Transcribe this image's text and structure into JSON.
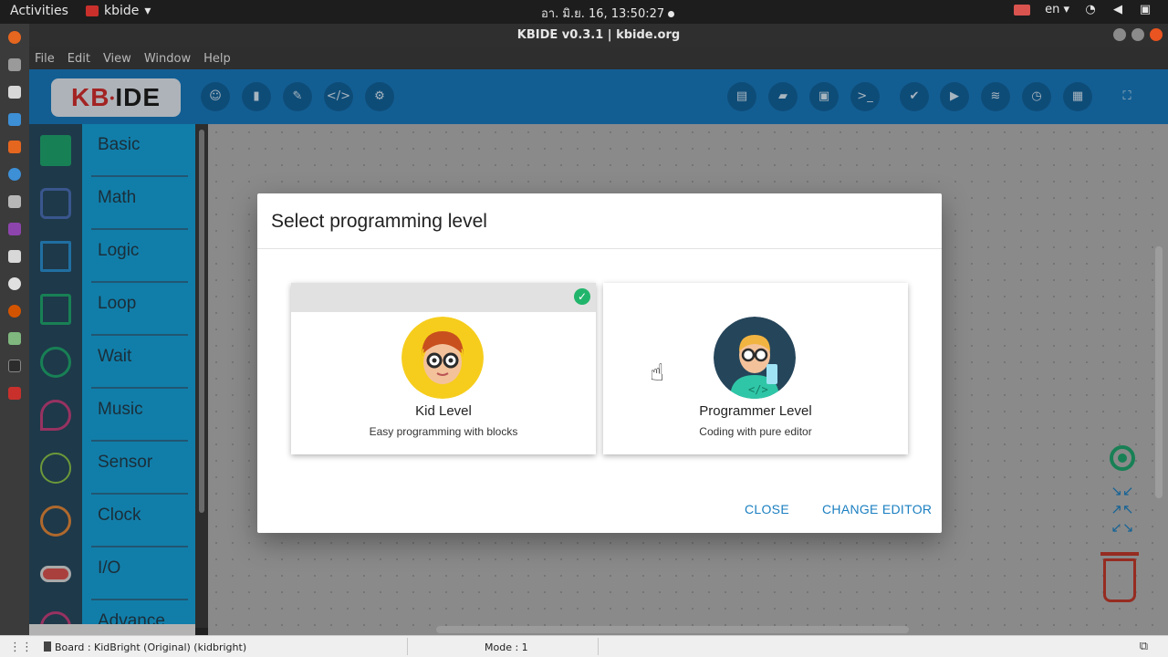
{
  "system": {
    "activities": "Activities",
    "app_menu": "kbide",
    "clock": "อา. มิ.ย. 16, 13:50:27",
    "language": "en"
  },
  "window": {
    "title": "KBIDE v0.3.1 | kbide.org"
  },
  "menubar": {
    "items": [
      "File",
      "Edit",
      "View",
      "Window",
      "Help"
    ]
  },
  "toolbar": {
    "logo": {
      "kb": "KB",
      "ide": "IDE"
    },
    "left_buttons": [
      "users-icon",
      "board-icon",
      "plug-icon",
      "code-icon",
      "gear-icon"
    ],
    "right_buttons": [
      "new-file-icon",
      "open-folder-icon",
      "save-icon",
      "terminal-icon",
      "check-icon",
      "play-icon",
      "wifi-icon",
      "timer-icon",
      "serial-icon"
    ]
  },
  "sidebar": {
    "categories": [
      {
        "label": "Basic",
        "icon": "grid-icon",
        "color": "#1fa56e"
      },
      {
        "label": "Math",
        "icon": "calculator-icon",
        "color": "#4a6fb5"
      },
      {
        "label": "Logic",
        "icon": "logic-tree-icon",
        "color": "#2a8fd0"
      },
      {
        "label": "Loop",
        "icon": "loop-icon",
        "color": "#1fa56e"
      },
      {
        "label": "Wait",
        "icon": "hourglass-icon",
        "color": "#1fa56e"
      },
      {
        "label": "Music",
        "icon": "music-note-icon",
        "color": "#c2417d"
      },
      {
        "label": "Sensor",
        "icon": "pulse-icon",
        "color": "#8bc34a"
      },
      {
        "label": "Clock",
        "icon": "clock-icon",
        "color": "#e0873a"
      },
      {
        "label": "I/O",
        "icon": "toggle-icon",
        "color": "#d9d9d9"
      },
      {
        "label": "Advance",
        "icon": "upload-icon",
        "color": "#c2417d"
      }
    ]
  },
  "dialog": {
    "title": "Select programming level",
    "cards": [
      {
        "name": "Kid Level",
        "description": "Easy programming with blocks",
        "selected": true
      },
      {
        "name": "Programmer Level",
        "description": "Coding with pure editor",
        "selected": false
      }
    ],
    "close_label": "CLOSE",
    "change_label": "CHANGE EDITOR"
  },
  "statusbar": {
    "board": "Board : KidBright (Original) (kidbright)",
    "mode": "Mode : 1"
  },
  "colors": {
    "toolbar": "#1879bd",
    "sidebar": "#17a2d9",
    "accent": "#1a7fc1",
    "selected_check": "#21b56b"
  }
}
